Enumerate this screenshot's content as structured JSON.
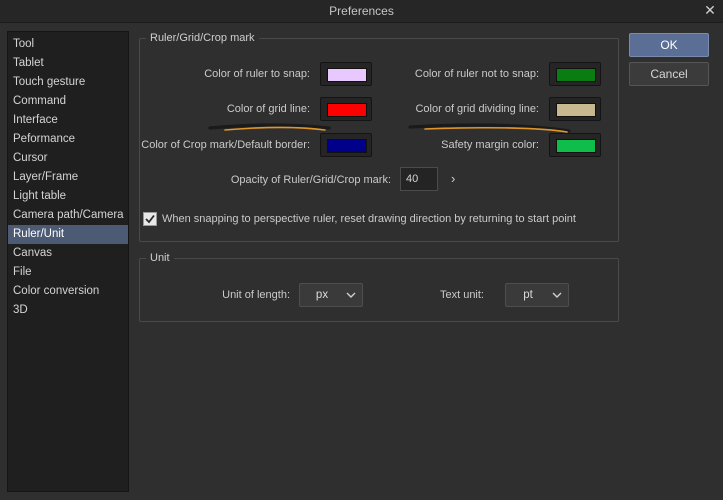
{
  "window": {
    "title": "Preferences"
  },
  "sidebar": {
    "items": [
      {
        "label": "Tool"
      },
      {
        "label": "Tablet"
      },
      {
        "label": "Touch gesture"
      },
      {
        "label": "Command"
      },
      {
        "label": "Interface"
      },
      {
        "label": "Peformance"
      },
      {
        "label": "Cursor"
      },
      {
        "label": "Layer/Frame"
      },
      {
        "label": "Light table"
      },
      {
        "label": "Camera path/Camera"
      },
      {
        "label": "Ruler/Unit"
      },
      {
        "label": "Canvas"
      },
      {
        "label": "File"
      },
      {
        "label": "Color conversion"
      },
      {
        "label": "3D"
      }
    ],
    "selected": "Ruler/Unit"
  },
  "ruler_group": {
    "legend": "Ruler/Grid/Crop mark",
    "color_ruler_snap": {
      "label": "Color of ruler to snap:",
      "color": "#e8c8ff"
    },
    "color_ruler_not_snap": {
      "label": "Color of ruler not to snap:",
      "color": "#0a7d12"
    },
    "color_grid_line": {
      "label": "Color of grid line:",
      "color": "#ff0000"
    },
    "color_grid_dividing": {
      "label": "Color of grid dividing line:",
      "color": "#c7b890"
    },
    "color_crop_mark": {
      "label": "Color of Crop mark/Default border:",
      "color": "#00008b"
    },
    "safety_margin": {
      "label": "Safety margin color:",
      "color": "#0ebd4a"
    },
    "opacity": {
      "label": "Opacity of Ruler/Grid/Crop mark:",
      "value": "40"
    },
    "snap_checkbox": {
      "label": "When snapping to perspective ruler, reset drawing direction by returning to start point",
      "checked": true
    }
  },
  "unit_group": {
    "legend": "Unit",
    "unit_of_length": {
      "label": "Unit of length:",
      "value": "px"
    },
    "text_unit": {
      "label": "Text unit:",
      "value": "pt"
    }
  },
  "buttons": {
    "ok": "OK",
    "cancel": "Cancel"
  },
  "annotation_color": "#e0952a"
}
